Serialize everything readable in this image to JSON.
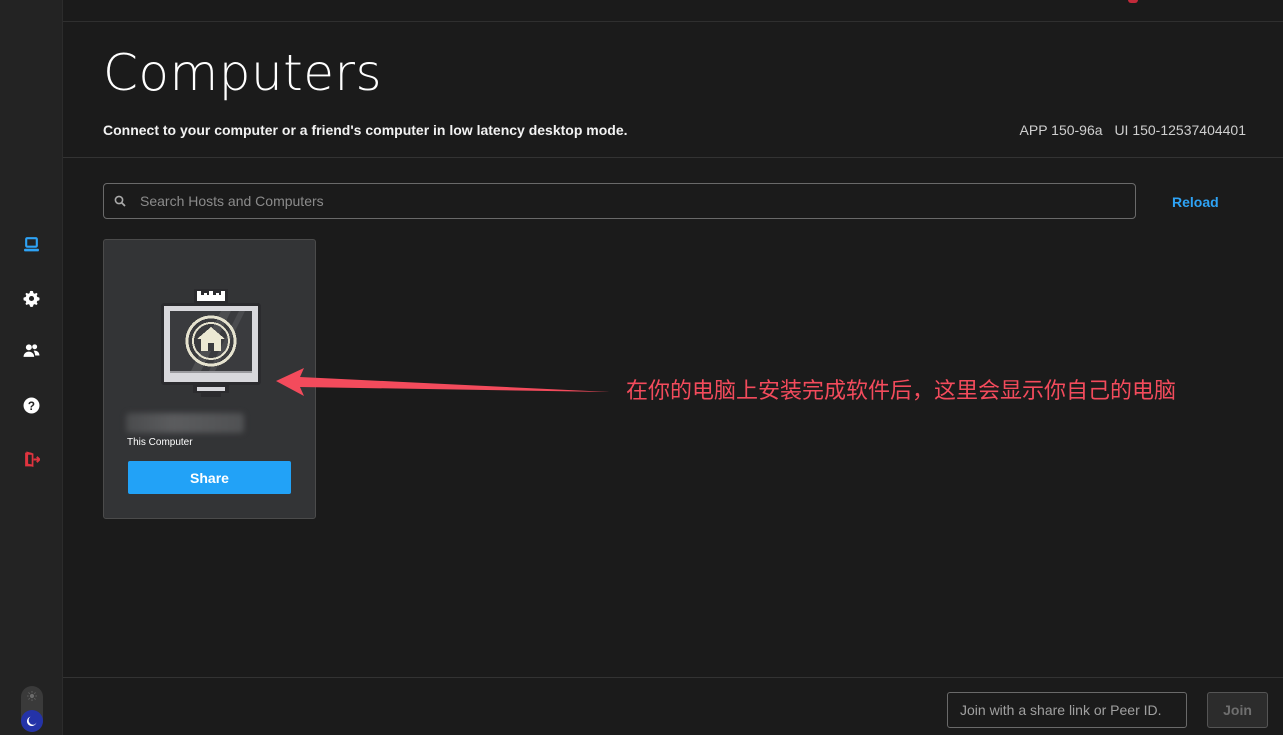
{
  "page": {
    "title": "Computers",
    "subtitle": "Connect to your computer or a friend's computer in low latency desktop mode.",
    "app_version": "APP 150-96a",
    "ui_version": "UI 150-12537404401"
  },
  "sidebar": {
    "items": [
      {
        "name": "computers",
        "icon": "laptop-icon",
        "active": true
      },
      {
        "name": "settings",
        "icon": "gear-icon"
      },
      {
        "name": "friends",
        "icon": "users-icon"
      },
      {
        "name": "help",
        "icon": "question-icon"
      },
      {
        "name": "logout",
        "icon": "logout-icon"
      }
    ],
    "theme": {
      "icons": [
        "sun-icon",
        "moon-icon"
      ],
      "mode": "dark"
    }
  },
  "search": {
    "placeholder": "Search Hosts and Computers",
    "value": ""
  },
  "reload_label": "Reload",
  "computer_card": {
    "label": "This Computer",
    "share_label": "Share"
  },
  "annotation": {
    "text": "在你的电脑上安装完成软件后，这里会显示你自己的电脑",
    "color": "#f34b5c"
  },
  "join": {
    "placeholder": "Join with a share link or Peer ID.",
    "value": "",
    "button_label": "Join"
  },
  "colors": {
    "accent": "#22a2f7",
    "background": "#1b1b1b",
    "sidebar": "#232323",
    "card": "#333436",
    "logout": "#e0343f"
  }
}
